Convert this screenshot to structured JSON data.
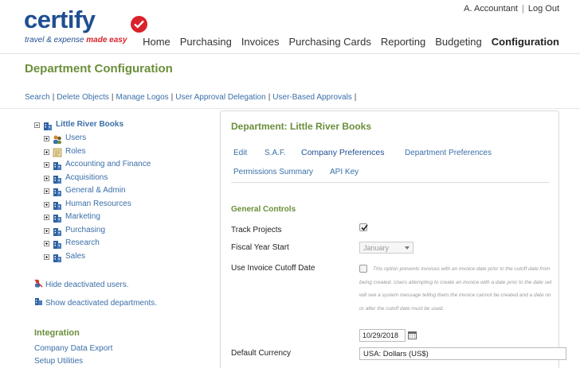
{
  "brand": {
    "name": "certify",
    "tagline_a": "travel & expense",
    "tagline_b": "made easy"
  },
  "user": {
    "name": "A. Accountant",
    "separator": "|",
    "logout": "Log Out"
  },
  "nav": {
    "items": [
      "Home",
      "Purchasing",
      "Invoices",
      "Purchasing Cards",
      "Reporting",
      "Budgeting",
      "Configuration"
    ],
    "active": "Configuration"
  },
  "page": {
    "title": "Department Configuration"
  },
  "subnav": {
    "links": [
      "Search",
      "Delete Objects",
      "Manage Logos",
      "User Approval Delegation",
      "User-Based Approvals"
    ],
    "separator": "|"
  },
  "tree": {
    "root": "Little River Books",
    "items": [
      "Users",
      "Roles",
      "Accounting and Finance",
      "Acquisitions",
      "General & Admin",
      "Human Resources",
      "Marketing",
      "Purchasing",
      "Research",
      "Sales"
    ]
  },
  "sidebar": {
    "hide_deactivated": "Hide deactivated users.",
    "show_deactivated": "Show deactivated departments.",
    "integration_heading": "Integration",
    "integration_links": [
      "Company Data Export",
      "Setup Utilities"
    ]
  },
  "panel": {
    "title": "Department: Little River Books",
    "tabs": [
      "Edit",
      "S.A.F.",
      "Company Preferences",
      "Department Preferences",
      "Permissions Summary",
      "API Key"
    ],
    "active_tab": "Company Preferences",
    "section": "General Controls",
    "fields": {
      "track_projects": {
        "label": "Track Projects",
        "checked": true
      },
      "fiscal_year_start": {
        "label": "Fiscal Year Start",
        "value": "January"
      },
      "invoice_cutoff": {
        "label": "Use Invoice Cutoff Date",
        "checked": false,
        "help": "This option prevents invoices with an invoice date prior to the cutoff date from being created. Users attempting to create an invoice with a date prior to the date set will see a system message telling them the invoice cannot be created and a date on or after the cutoff date must be used.",
        "date": "10/29/2018"
      },
      "default_currency": {
        "label": "Default Currency",
        "value": "USA: Dollars (US$)"
      }
    }
  },
  "colors": {
    "brand_blue": "#1f4f91",
    "brand_red": "#d9222a",
    "heading_green": "#6a8f3a",
    "link_blue": "#3a6fa8"
  }
}
